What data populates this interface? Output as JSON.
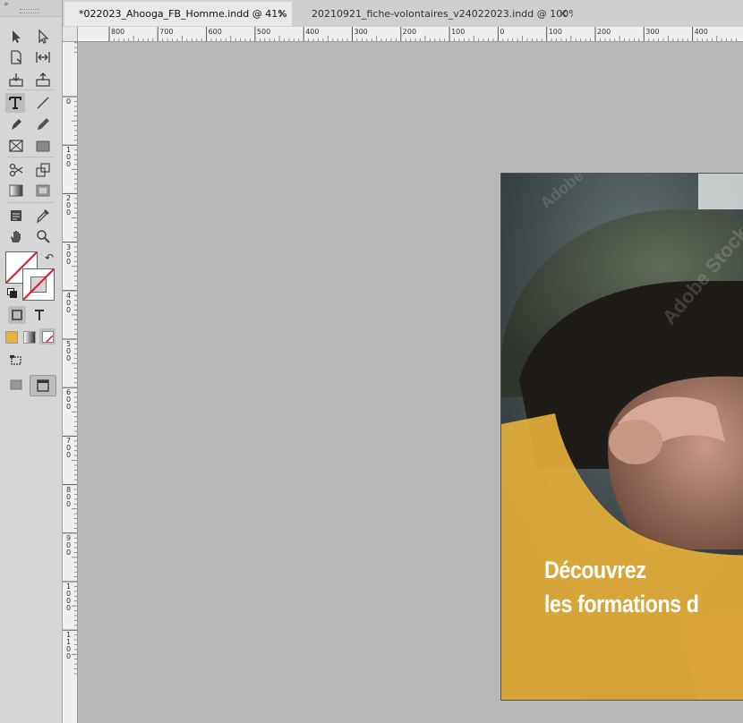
{
  "tabs": [
    {
      "label": "*022023_Ahooga_FB_Homme.indd @ 41%",
      "active": true,
      "close": "×"
    },
    {
      "label": "20210921_fiche-volontaires_v24022023.indd @ 100%",
      "active": false,
      "close": "×"
    }
  ],
  "ruler": {
    "h_labels": [
      "800",
      "700",
      "600",
      "500",
      "400",
      "300",
      "200",
      "100",
      "0",
      "100",
      "200",
      "300",
      "400"
    ],
    "v_labels": [
      "0",
      "0",
      "100",
      "200",
      "300",
      "400",
      "500",
      "600",
      "700",
      "800",
      "900",
      "1000",
      "1100"
    ]
  },
  "document": {
    "headline_line1": "Découvrez",
    "headline_line2": "les formations d",
    "watermark": "Adobe Stock",
    "accent_color": "#e8b13a"
  },
  "colors": {
    "fill_swatch": "#e8b13a"
  }
}
